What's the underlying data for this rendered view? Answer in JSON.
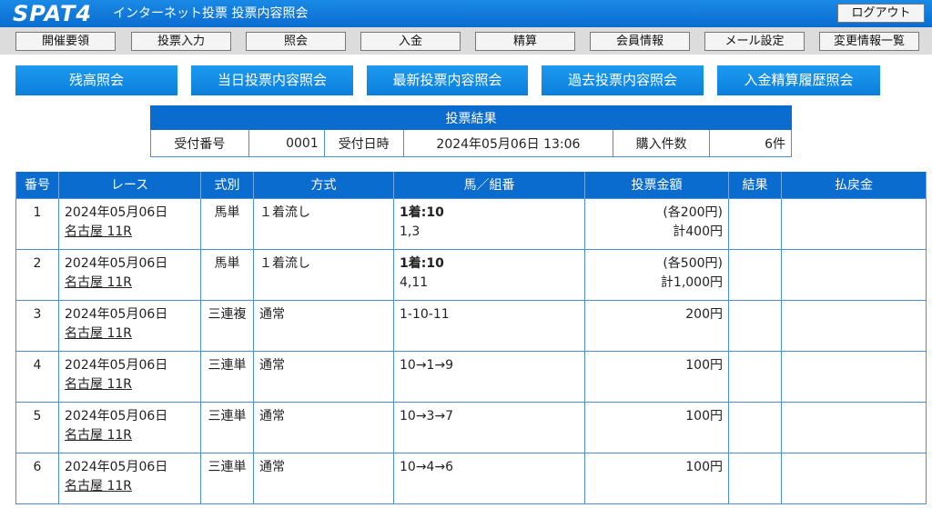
{
  "header": {
    "logo": "SPAT4",
    "title": "インターネット投票 投票内容照会",
    "logout_label": "ログアウト"
  },
  "nav": [
    "開催要領",
    "投票入力",
    "照会",
    "入金",
    "精算",
    "会員情報",
    "メール設定",
    "変更情報一覧"
  ],
  "subnav": [
    "残高照会",
    "当日投票内容照会",
    "最新投票内容照会",
    "過去投票内容照会",
    "入金精算履歴照会"
  ],
  "summary": {
    "title": "投票結果",
    "receipt_no_label": "受付番号",
    "receipt_no": "0001",
    "receipt_date_label": "受付日時",
    "receipt_date": "2024年05月06日 13:06",
    "count_label": "購入件数",
    "count": "6件"
  },
  "table": {
    "headers": [
      "番号",
      "レース",
      "式別",
      "方式",
      "馬／組番",
      "投票金額",
      "結果",
      "払戻金"
    ],
    "rows": [
      {
        "no": "1",
        "date": "2024年05月06日",
        "race": "名古屋 11R",
        "type": "馬単",
        "method": "１着流し",
        "combo_head": "1着:10",
        "combo": "1,3",
        "amount1": "(各200円)",
        "amount2": "計400円",
        "result": "",
        "payout": ""
      },
      {
        "no": "2",
        "date": "2024年05月06日",
        "race": "名古屋 11R",
        "type": "馬単",
        "method": "１着流し",
        "combo_head": "1着:10",
        "combo": "4,11",
        "amount1": "(各500円)",
        "amount2": "計1,000円",
        "result": "",
        "payout": ""
      },
      {
        "no": "3",
        "date": "2024年05月06日",
        "race": "名古屋 11R",
        "type": "三連複",
        "method": "通常",
        "combo_head": "",
        "combo": "1-10-11",
        "amount1": "200円",
        "amount2": "",
        "result": "",
        "payout": ""
      },
      {
        "no": "4",
        "date": "2024年05月06日",
        "race": "名古屋 11R",
        "type": "三連単",
        "method": "通常",
        "combo_head": "",
        "combo": "10→1→9",
        "amount1": "100円",
        "amount2": "",
        "result": "",
        "payout": ""
      },
      {
        "no": "5",
        "date": "2024年05月06日",
        "race": "名古屋 11R",
        "type": "三連単",
        "method": "通常",
        "combo_head": "",
        "combo": "10→3→7",
        "amount1": "100円",
        "amount2": "",
        "result": "",
        "payout": ""
      },
      {
        "no": "6",
        "date": "2024年05月06日",
        "race": "名古屋 11R",
        "type": "三連単",
        "method": "通常",
        "combo_head": "",
        "combo": "10→4→6",
        "amount1": "100円",
        "amount2": "",
        "result": "",
        "payout": ""
      }
    ]
  }
}
